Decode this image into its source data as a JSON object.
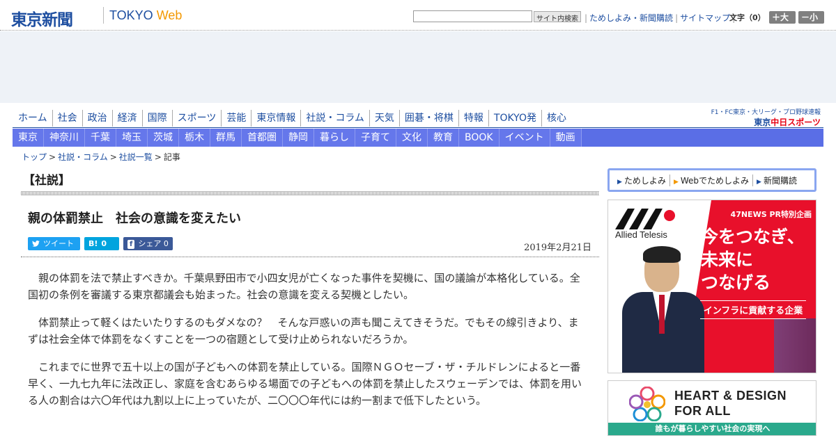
{
  "header": {
    "logo": "東京新聞",
    "brand_tokyo": "TOKYO",
    "brand_web": "Web",
    "search_button": "サイト内検索",
    "links": [
      "ためしよみ・新聞購読",
      "サイトマップ"
    ],
    "font_label": "文字（0）",
    "font_large": "＋大",
    "font_small": "－小"
  },
  "gnav": [
    "ホーム",
    "社会",
    "政治",
    "経済",
    "国際",
    "スポーツ",
    "芸能",
    "東京情報",
    "社説・コラム",
    "天気",
    "囲碁・将棋",
    "特報",
    "TOKYO発",
    "核心"
  ],
  "chunichi": {
    "top": "F1・FC東京・大リーグ・プロ野球速報",
    "main_prefix": "東京",
    "main_red": "中日スポーツ"
  },
  "snav": [
    "東京",
    "神奈川",
    "千葉",
    "埼玉",
    "茨城",
    "栃木",
    "群馬",
    "首都圏",
    "静岡",
    "暮らし",
    "子育て",
    "文化",
    "教育",
    "BOOK",
    "イベント",
    "動画"
  ],
  "breadcrumb": [
    "トップ",
    "社説・コラム",
    "社説一覧",
    "記事"
  ],
  "article": {
    "section": "【社説】",
    "title": "親の体罰禁止　社会の意識を変えたい",
    "tweet": "ツイート",
    "hatena_count": "0",
    "fb_label": "シェア",
    "fb_count": "0",
    "date": "2019年2月21日",
    "paragraphs": [
      "親の体罰を法で禁止すべきか。千葉県野田市で小四女児が亡くなった事件を契機に、国の議論が本格化している。全国初の条例を審議する東京都議会も始まった。社会の意識を変える契機としたい。",
      "体罰禁止って軽くはたいたりするのもダメなの？　そんな戸惑いの声も聞こえてきそうだ。でもその線引きより、まずは社会全体で体罰をなくすことを一つの宿題として受け止められないだろうか。",
      "これまでに世界で五十以上の国が子どもへの体罰を禁止している。国際ＮＧＯセーブ・ザ・チルドレンによると一番早く、一九七九年に法改正し、家庭を含むあらゆる場面での子どもへの体罰を禁止したスウェーデンでは、体罰を用いる人の割合は六〇年代は九割以上に上っていたが、二〇〇〇年代には約一割まで低下したという。"
    ]
  },
  "sidebar": {
    "links": [
      "ためしよみ",
      "Webでためしよみ",
      "新聞購読"
    ],
    "ad1": {
      "logo_text": "Allied Telesis",
      "pr": "47NEWS PR特別企画",
      "headline": "今をつなぎ、\n未来に\nつなげる",
      "sub": "インフラに貢献する企業"
    },
    "ad2": {
      "title": "HEART & DESIGN\nFOR ALL",
      "band": "誰もが暮らしやすい社会の実現へ"
    }
  }
}
